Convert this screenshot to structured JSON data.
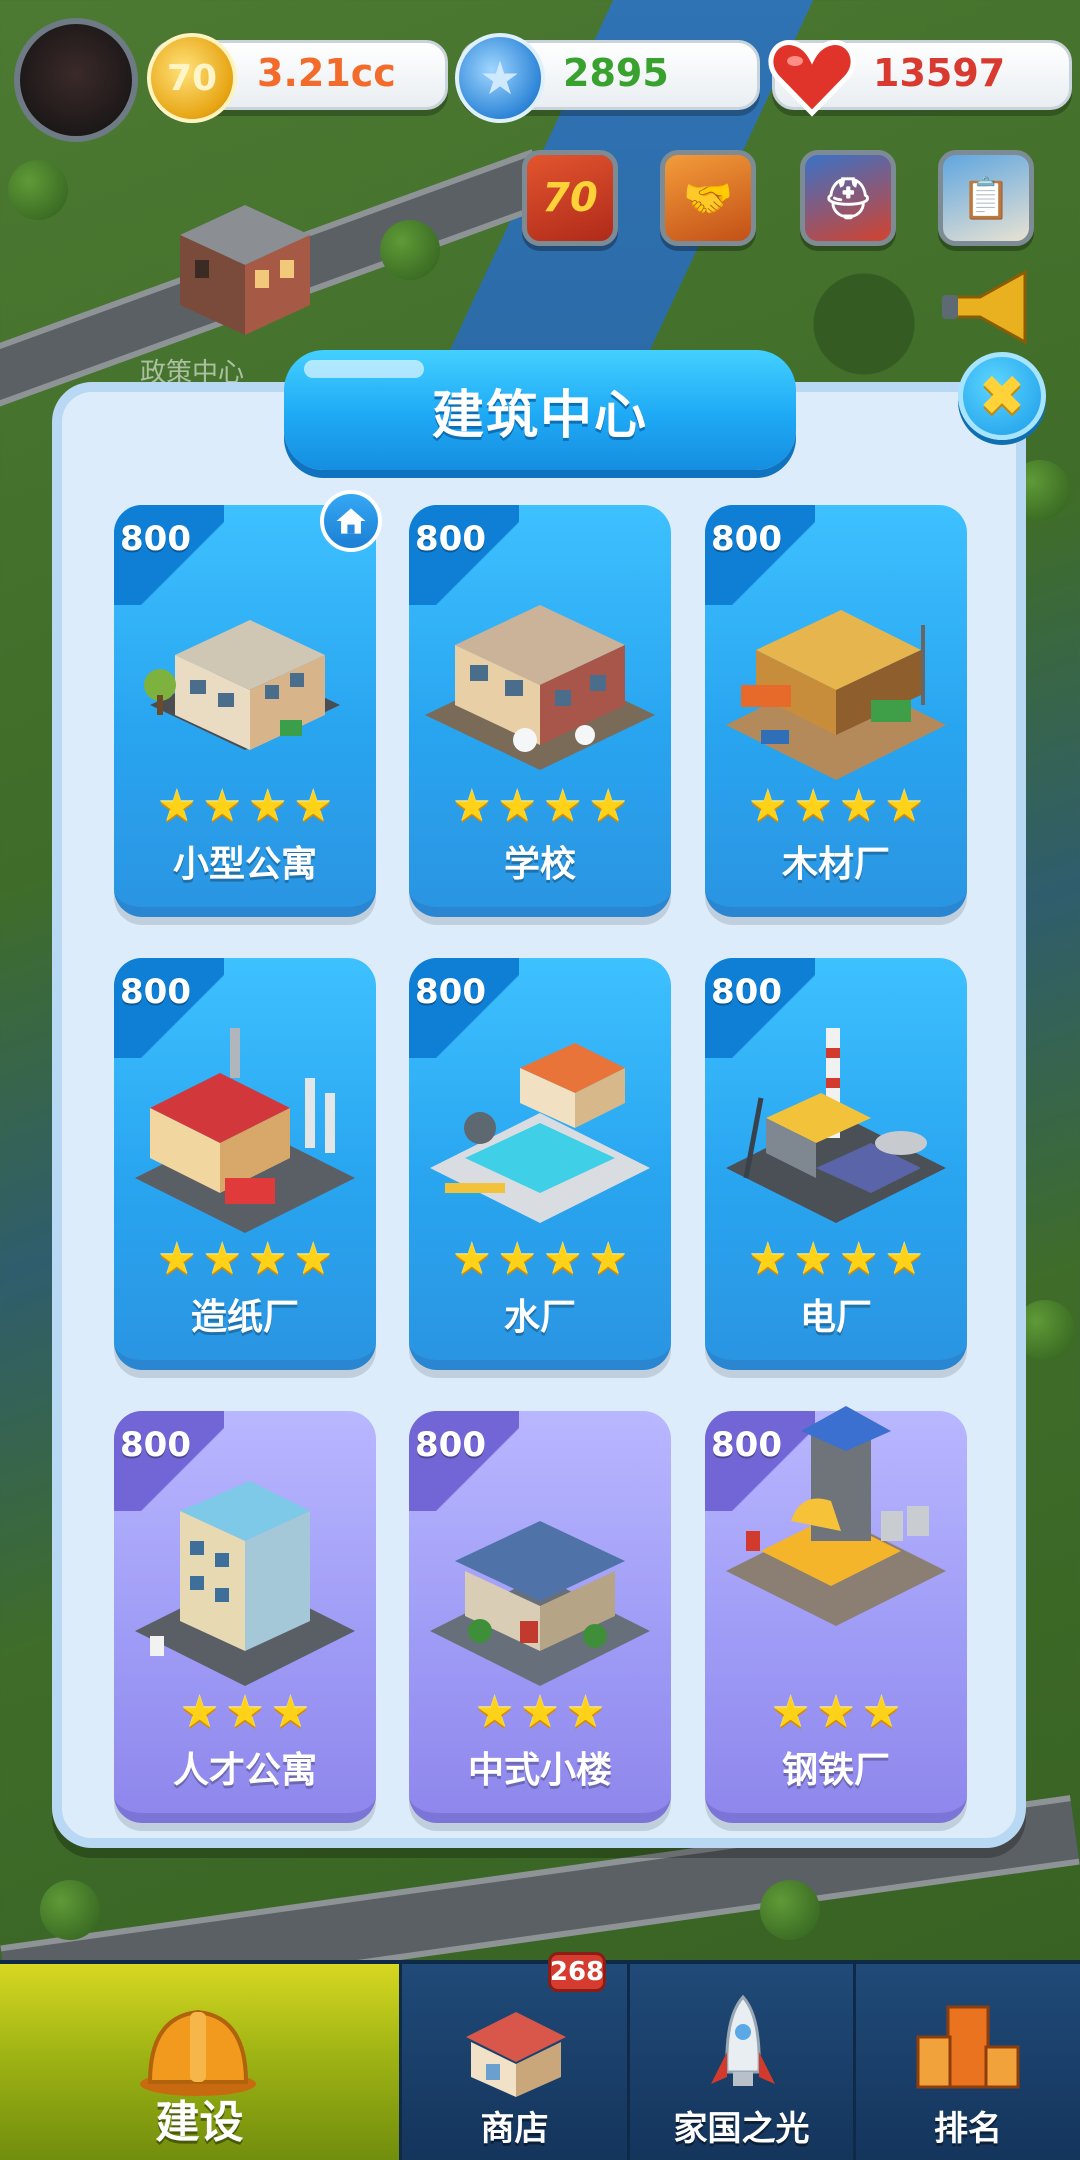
{
  "top_bar": {
    "coins": "3.21cc",
    "coin_icon_text": "70",
    "stars": "2895",
    "hearts": "13597",
    "coins_icon": "gold-coin-icon",
    "stars_icon": "blue-star-coin-icon",
    "hearts_icon": "red-heart-icon"
  },
  "quick_buttons": [
    {
      "icon": "anniversary-70-icon",
      "label": "70"
    },
    {
      "icon": "handshake-icon"
    },
    {
      "icon": "rescue-icon"
    },
    {
      "icon": "task-list-icon"
    }
  ],
  "map": {
    "policy_center_label": "政策中心"
  },
  "modal": {
    "title": "建筑中心",
    "close_icon": "close-x-icon",
    "cards": [
      {
        "price": "800",
        "name": "小型公寓",
        "stars": 4,
        "theme": "blue",
        "badge": "home-icon"
      },
      {
        "price": "800",
        "name": "学校",
        "stars": 4,
        "theme": "blue"
      },
      {
        "price": "800",
        "name": "木材厂",
        "stars": 4,
        "theme": "blue"
      },
      {
        "price": "800",
        "name": "造纸厂",
        "stars": 4,
        "theme": "blue"
      },
      {
        "price": "800",
        "name": "水厂",
        "stars": 4,
        "theme": "blue"
      },
      {
        "price": "800",
        "name": "电厂",
        "stars": 4,
        "theme": "blue"
      },
      {
        "price": "800",
        "name": "人才公寓",
        "stars": 3,
        "theme": "purple"
      },
      {
        "price": "800",
        "name": "中式小楼",
        "stars": 3,
        "theme": "purple"
      },
      {
        "price": "800",
        "name": "钢铁厂",
        "stars": 3,
        "theme": "purple"
      }
    ]
  },
  "bottom_nav": {
    "build": "建设",
    "shop": "商店",
    "shop_badge": "268",
    "light": "家国之光",
    "rank": "排名"
  },
  "colors": {
    "card_blue": "#29a5f0",
    "card_purple": "#9f9cf6",
    "modal_bg": "#dcecfb",
    "star": "#ffd21a"
  }
}
